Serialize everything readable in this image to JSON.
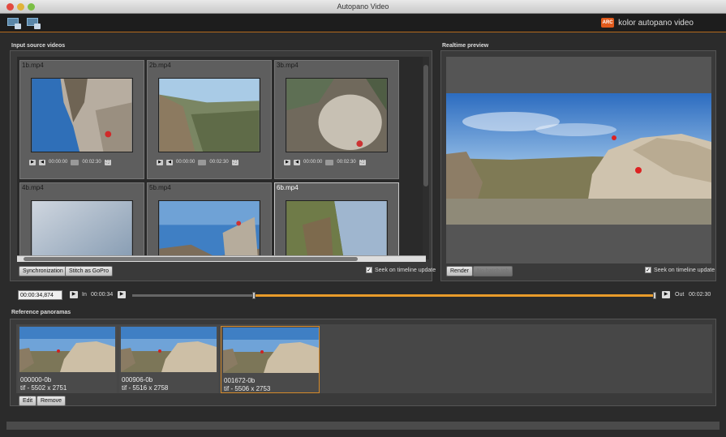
{
  "window": {
    "title": "Autopano Video"
  },
  "toolbar": {
    "brand_logo_text": "ARC",
    "brand_text": "kolor autopano video"
  },
  "sources": {
    "title": "Input source videos",
    "tiles": [
      {
        "name": "1b.mp4",
        "time_current": "00:00:00",
        "time_total": "00:02:30"
      },
      {
        "name": "2b.mp4",
        "time_current": "00:00:00",
        "time_total": "00:02:30"
      },
      {
        "name": "3b.mp4",
        "time_current": "00:00:00",
        "time_total": "00:02:30"
      },
      {
        "name": "4b.mp4"
      },
      {
        "name": "5b.mp4"
      },
      {
        "name": "6b.mp4"
      }
    ],
    "sync_button": "Synchronization",
    "stitch_button": "Stitch  as GoPro",
    "seek_label": "Seek on timeline update"
  },
  "preview": {
    "title": "Realtime preview",
    "render_button": "Render",
    "batch_button": "No batch job",
    "seek_label": "Seek on timeline update"
  },
  "timeline": {
    "current": "00:00:34,874",
    "in_label": "In",
    "in_time": "00:00:34",
    "out_label": "Out",
    "out_time": "00:02:30",
    "in_fraction": 0.232,
    "out_fraction": 1.0
  },
  "reference": {
    "title": "Reference panoramas",
    "panoramas": [
      {
        "name": "000000-0b",
        "dims": "tif - 5502 x 2751"
      },
      {
        "name": "000906-0b",
        "dims": "tif - 5516 x 2758"
      },
      {
        "name": "001672-0b",
        "dims": "tif - 5506 x 2753"
      }
    ],
    "edit_button": "Edit",
    "remove_button": "Remove"
  }
}
